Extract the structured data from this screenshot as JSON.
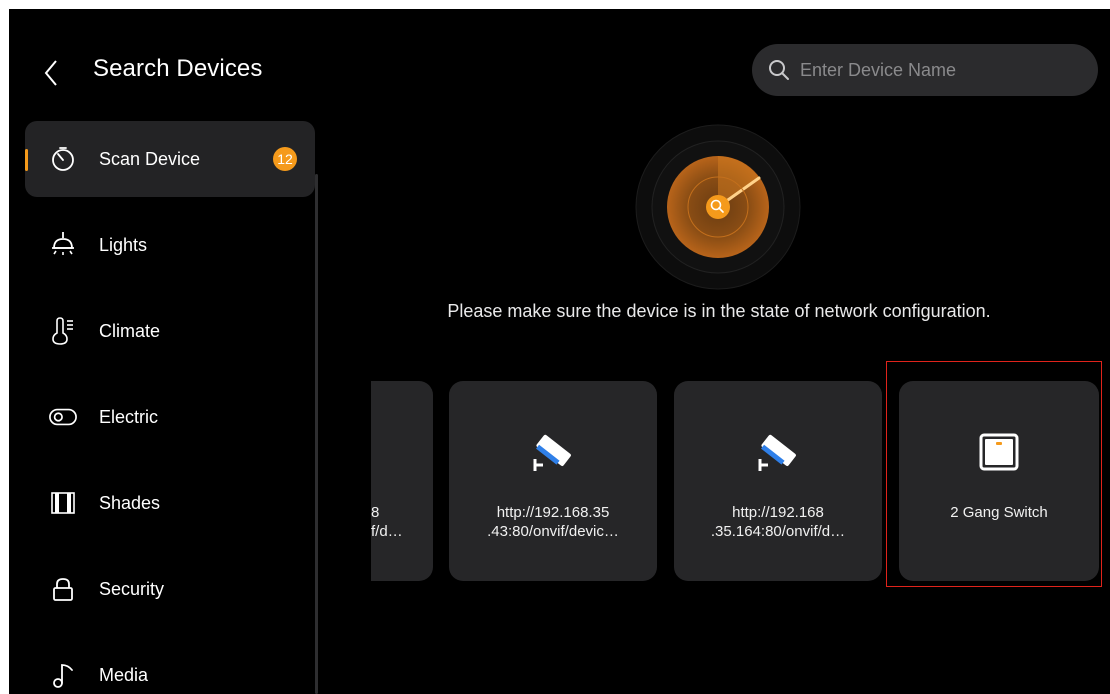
{
  "header": {
    "title": "Search Devices",
    "back_icon": "chevron-left-icon"
  },
  "search": {
    "placeholder": "Enter Device Name",
    "value": "",
    "icon": "search-icon"
  },
  "sidebar": {
    "items": [
      {
        "label": "Scan Device",
        "icon": "timer-icon",
        "active": true,
        "badge": "12"
      },
      {
        "label": "Lights",
        "icon": "ceiling-light-icon"
      },
      {
        "label": "Climate",
        "icon": "thermometer-icon"
      },
      {
        "label": "Electric",
        "icon": "toggle-switch-icon"
      },
      {
        "label": "Shades",
        "icon": "curtain-icon"
      },
      {
        "label": "Security",
        "icon": "lock-icon"
      },
      {
        "label": "Media",
        "icon": "music-note-icon"
      }
    ]
  },
  "main": {
    "radar_icon": "radar-scan-icon",
    "hint": "Please make sure the device is in the state of network configuration."
  },
  "devices": [
    {
      "name": "8\nf/d…",
      "icon": "camera-icon",
      "partial": true
    },
    {
      "name": "http://192.168.35\n.43:80/onvif/devic…",
      "icon": "security-camera-icon"
    },
    {
      "name": "http://192.168\n.35.164:80/onvif/d…",
      "icon": "security-camera-icon"
    },
    {
      "name": "2 Gang Switch",
      "icon": "wall-switch-icon",
      "selected": true
    }
  ],
  "colors": {
    "accent": "#f59a1b",
    "background": "#000000",
    "card": "#262628",
    "selection": "#e0231b"
  }
}
